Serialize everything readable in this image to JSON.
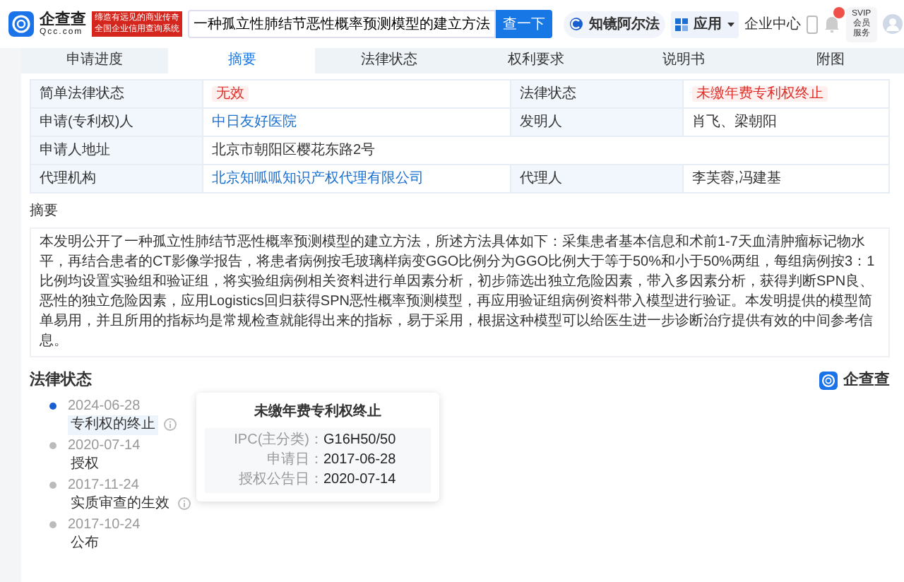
{
  "header": {
    "logo": {
      "name": "企查查",
      "domain": "Qcc.com"
    },
    "slogan": [
      "缔造有远见的商业传奇",
      "全国企业信用查询系统"
    ],
    "search": {
      "value": "一种孤立性肺结节恶性概率预测模型的建立方法",
      "button": "查一下"
    },
    "links": [
      {
        "kind": "alpha",
        "label": "知镜阿尔法"
      },
      {
        "kind": "apps",
        "label": "应用"
      },
      {
        "kind": "plain",
        "label": "企业中心"
      }
    ],
    "svip": [
      "SVIP",
      "会员服务"
    ]
  },
  "tabs": [
    {
      "label": "申请进度",
      "selected": false
    },
    {
      "label": "摘要",
      "selected": true
    },
    {
      "label": "法律状态",
      "selected": false
    },
    {
      "label": "权利要求",
      "selected": false
    },
    {
      "label": "说明书",
      "selected": false
    },
    {
      "label": "附图",
      "selected": false
    }
  ],
  "info": [
    [
      {
        "label": "简单法律状态",
        "value": "无效",
        "kind": "tag"
      },
      {
        "label": "法律状态",
        "value": "未缴年费专利权终止",
        "kind": "tag"
      }
    ],
    [
      {
        "label": "申请(专利权)人",
        "value": "中日友好医院",
        "kind": "link"
      },
      {
        "label": "发明人",
        "value": "肖飞、梁朝阳",
        "kind": "text"
      }
    ],
    [
      {
        "label": "申请人地址",
        "value": "北京市朝阳区樱花东路2号",
        "kind": "text"
      }
    ],
    [
      {
        "label": "代理机构",
        "value": "北京知呱呱知识产权代理有限公司",
        "kind": "link"
      },
      {
        "label": "代理人",
        "value": "李芙蓉,冯建基",
        "kind": "text"
      }
    ]
  ],
  "abstract": {
    "title": "摘要",
    "text": "本发明公开了一种孤立性肺结节恶性概率预测模型的建立方法，所述方法具体如下：采集患者基本信息和术前1-7天血清肿瘤标记物水平，再结合患者的CT影像学报告，将患者病例按毛玻璃样病变GGO比例分为GGO比例大于等于50%和小于50%两组，每组病例按3：1比例均设置实验组和验证组，将实验组病例相关资料进行单因素分析，初步筛选出独立危险因素，带入多因素分析，获得判断SPN良、恶性的独立危险因素，应用Logistics回归获得SPN恶性概率预测模型，再应用验证组病例资料带入模型进行验证。本发明提供的模型简单易用，并且所用的指标均是常规检查就能得出来的指标，易于采用，根据这种模型可以给医生进一步诊断治疗提供有效的中间参考信息。"
  },
  "legal_status": {
    "title": "法律状态",
    "brand": "企查查",
    "events": [
      {
        "date": "2024-06-28",
        "label": "专利权的终止",
        "info": true,
        "selected": true
      },
      {
        "date": "2020-07-14",
        "label": "授权",
        "info": false,
        "selected": false
      },
      {
        "date": "2017-11-24",
        "label": "实质审查的生效",
        "info": true,
        "selected": false
      },
      {
        "date": "2017-10-24",
        "label": "公布",
        "info": false,
        "selected": false
      }
    ],
    "tooltip": {
      "title": "未缴年费专利权终止",
      "fields": [
        {
          "label": "IPC(主分类)：",
          "value": "G16H50/50"
        },
        {
          "label": "申请日：",
          "value": "2017-06-28"
        },
        {
          "label": "授权公告日：",
          "value": "2020-07-14"
        }
      ]
    }
  }
}
